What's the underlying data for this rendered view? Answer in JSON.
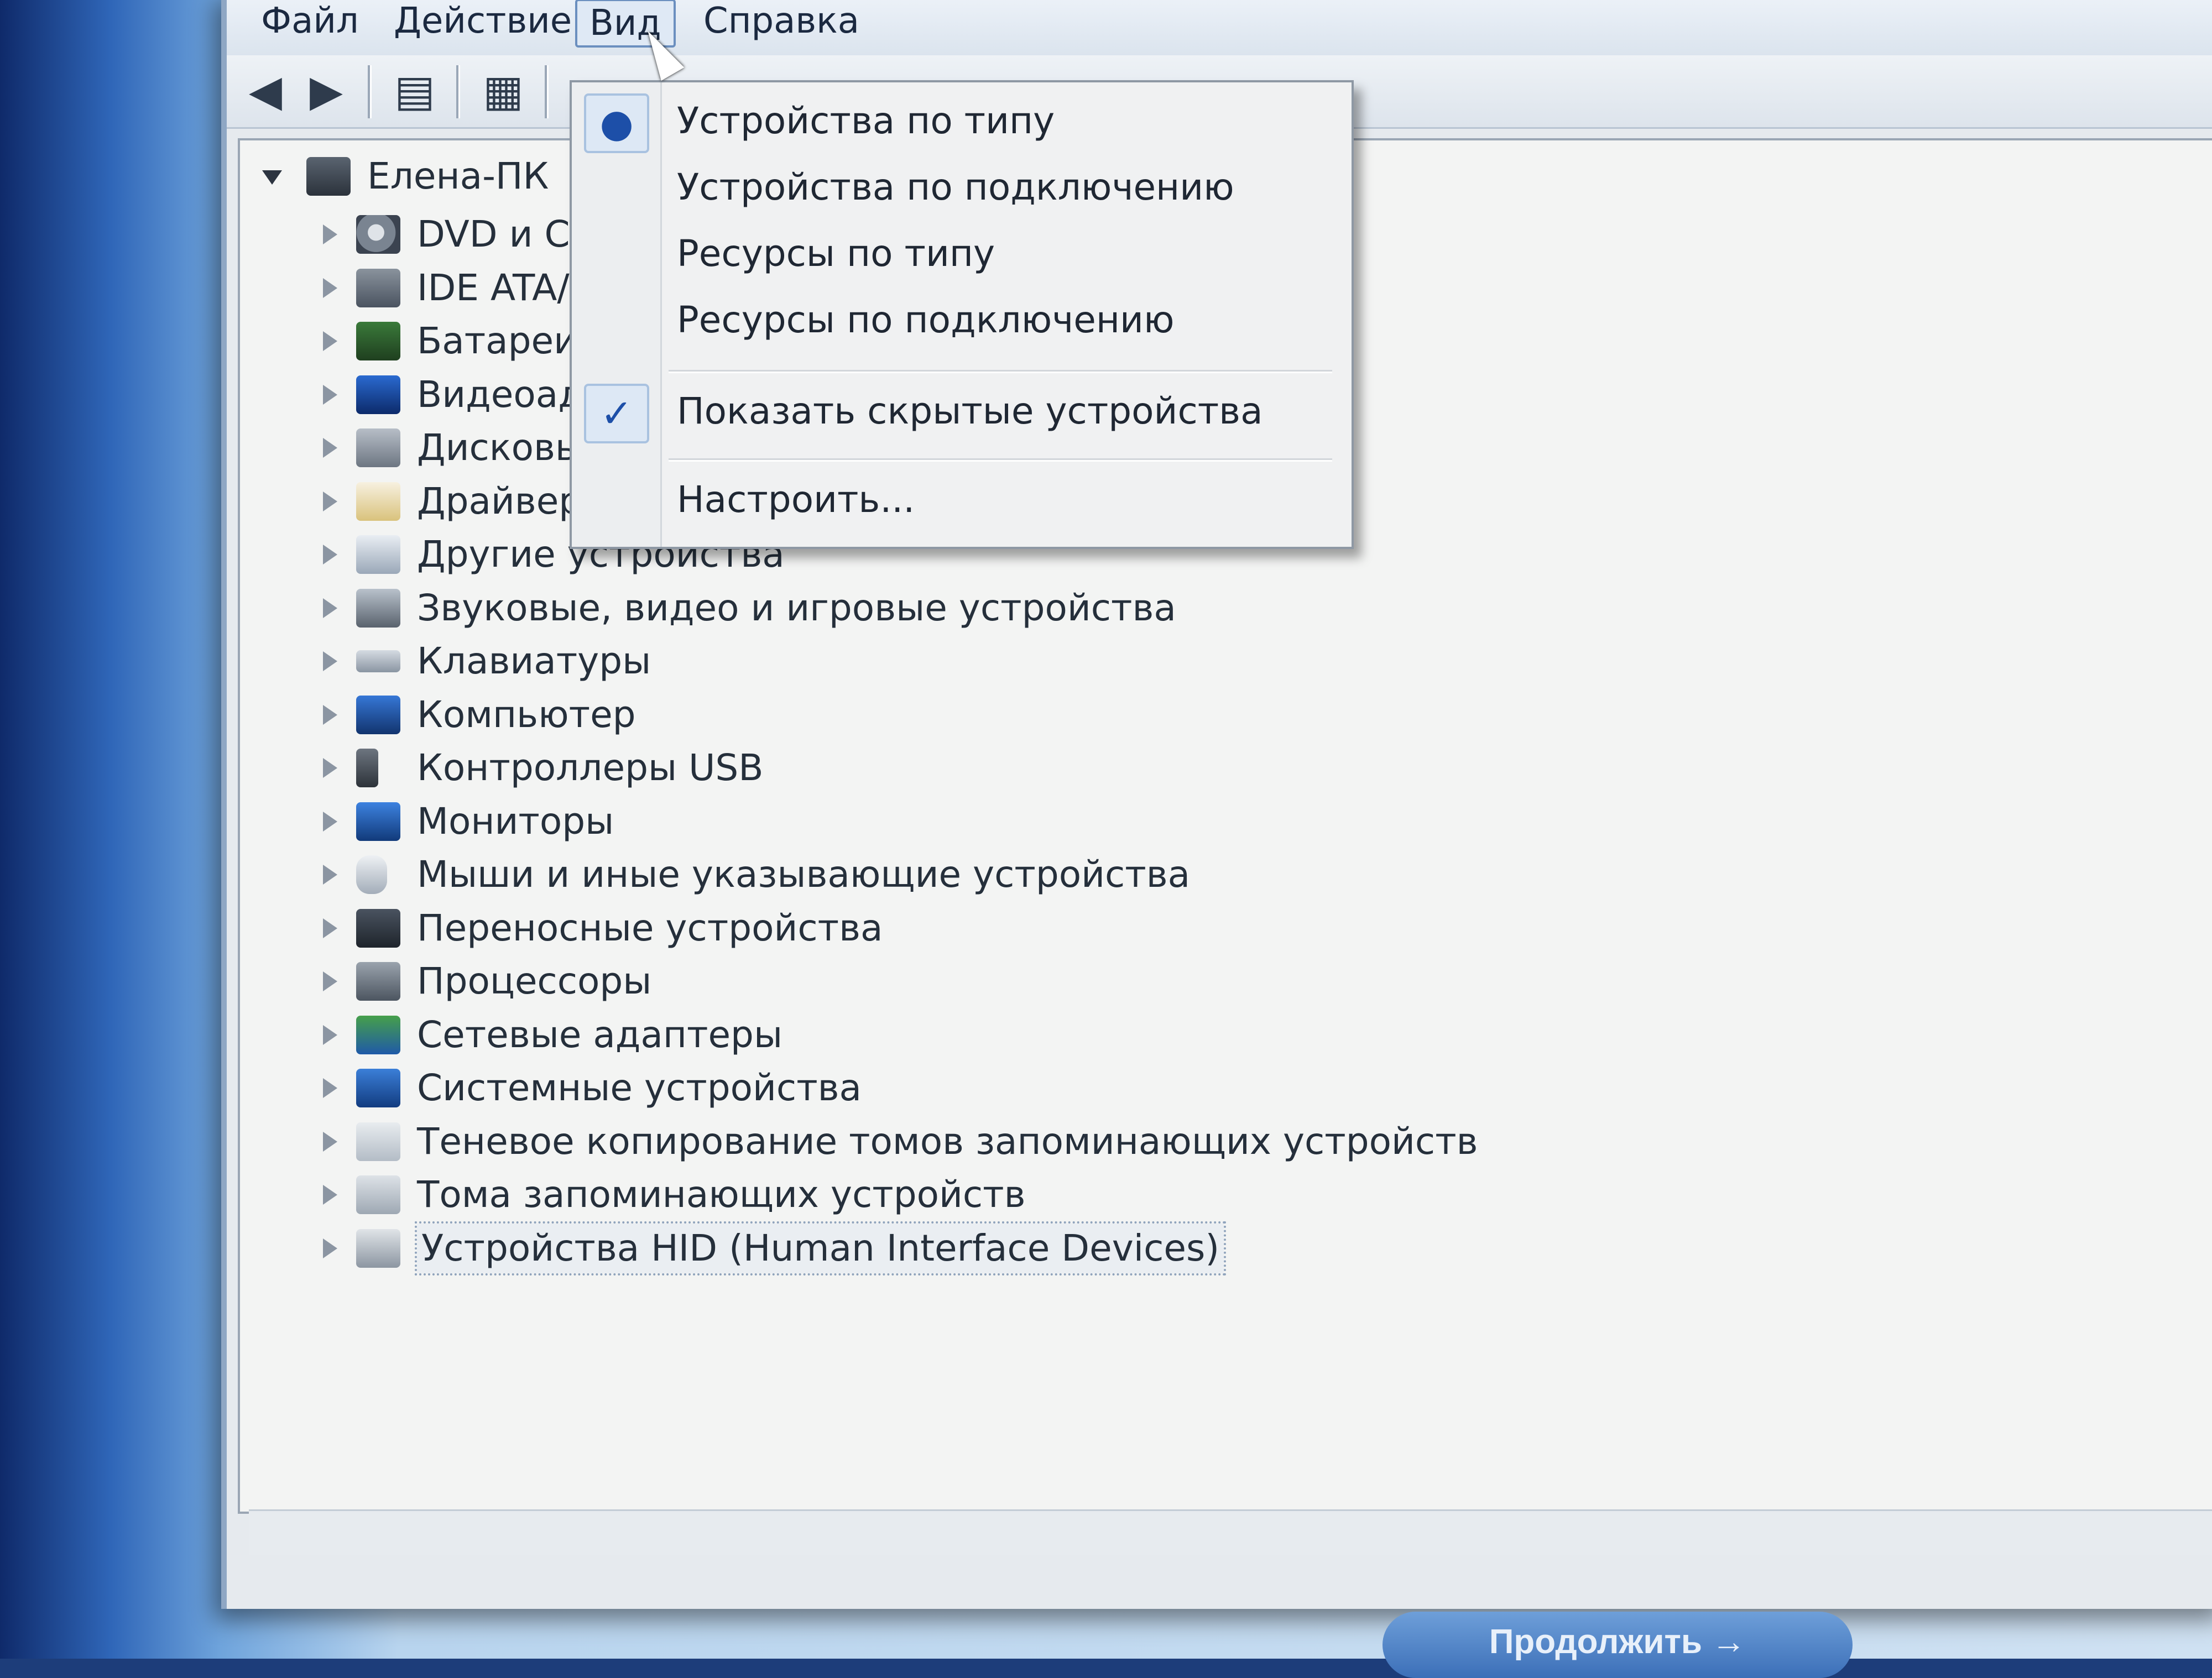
{
  "menu": {
    "file": "Файл",
    "action": "Действие",
    "view": "Вид",
    "help": "Справка"
  },
  "toolbar": {
    "back_icon": "arrow-left-icon",
    "forward_icon": "arrow-right-icon",
    "console_tree_icon": "console-tree-icon",
    "properties_icon": "properties-icon"
  },
  "tree": {
    "root": "Елена-ПК",
    "items": [
      {
        "label": "DVD и CD",
        "icon": "dvd-icon"
      },
      {
        "label": "IDE ATA/",
        "icon": "ide-icon"
      },
      {
        "label": "Батареи",
        "icon": "battery-icon"
      },
      {
        "label": "Видеоада",
        "icon": "video-adapter-icon"
      },
      {
        "label": "Дисковы",
        "icon": "disk-icon"
      },
      {
        "label": "Драйверы",
        "icon": "driver-icon"
      },
      {
        "label": "Другие устройства",
        "icon": "other-devices-icon"
      },
      {
        "label": "Звуковые, видео и игровые устройства",
        "icon": "sound-icon"
      },
      {
        "label": "Клавиатуры",
        "icon": "keyboard-icon"
      },
      {
        "label": "Компьютер",
        "icon": "computer-icon"
      },
      {
        "label": "Контроллеры USB",
        "icon": "usb-icon"
      },
      {
        "label": "Мониторы",
        "icon": "monitor-icon"
      },
      {
        "label": "Мыши и иные указывающие устройства",
        "icon": "mouse-icon"
      },
      {
        "label": "Переносные устройства",
        "icon": "portable-device-icon"
      },
      {
        "label": "Процессоры",
        "icon": "processor-icon"
      },
      {
        "label": "Сетевые адаптеры",
        "icon": "network-adapter-icon"
      },
      {
        "label": "Системные устройства",
        "icon": "system-device-icon"
      },
      {
        "label": "Теневое копирование томов запоминающих устройств",
        "icon": "shadow-copy-icon"
      },
      {
        "label": "Тома запоминающих устройств",
        "icon": "storage-volume-icon"
      },
      {
        "label": "Устройства HID (Human Interface Devices)",
        "icon": "hid-icon"
      }
    ]
  },
  "view_menu": {
    "by_type": "Устройства по типу",
    "by_connection": "Устройства по подключению",
    "resources_by_type": "Ресурсы по типу",
    "resources_by_connection": "Ресурсы по подключению",
    "show_hidden": "Показать скрытые устройства",
    "customize": "Настроить...",
    "radio_mark": "●",
    "check_mark": "✓"
  },
  "bottom_button": "Продолжить →"
}
